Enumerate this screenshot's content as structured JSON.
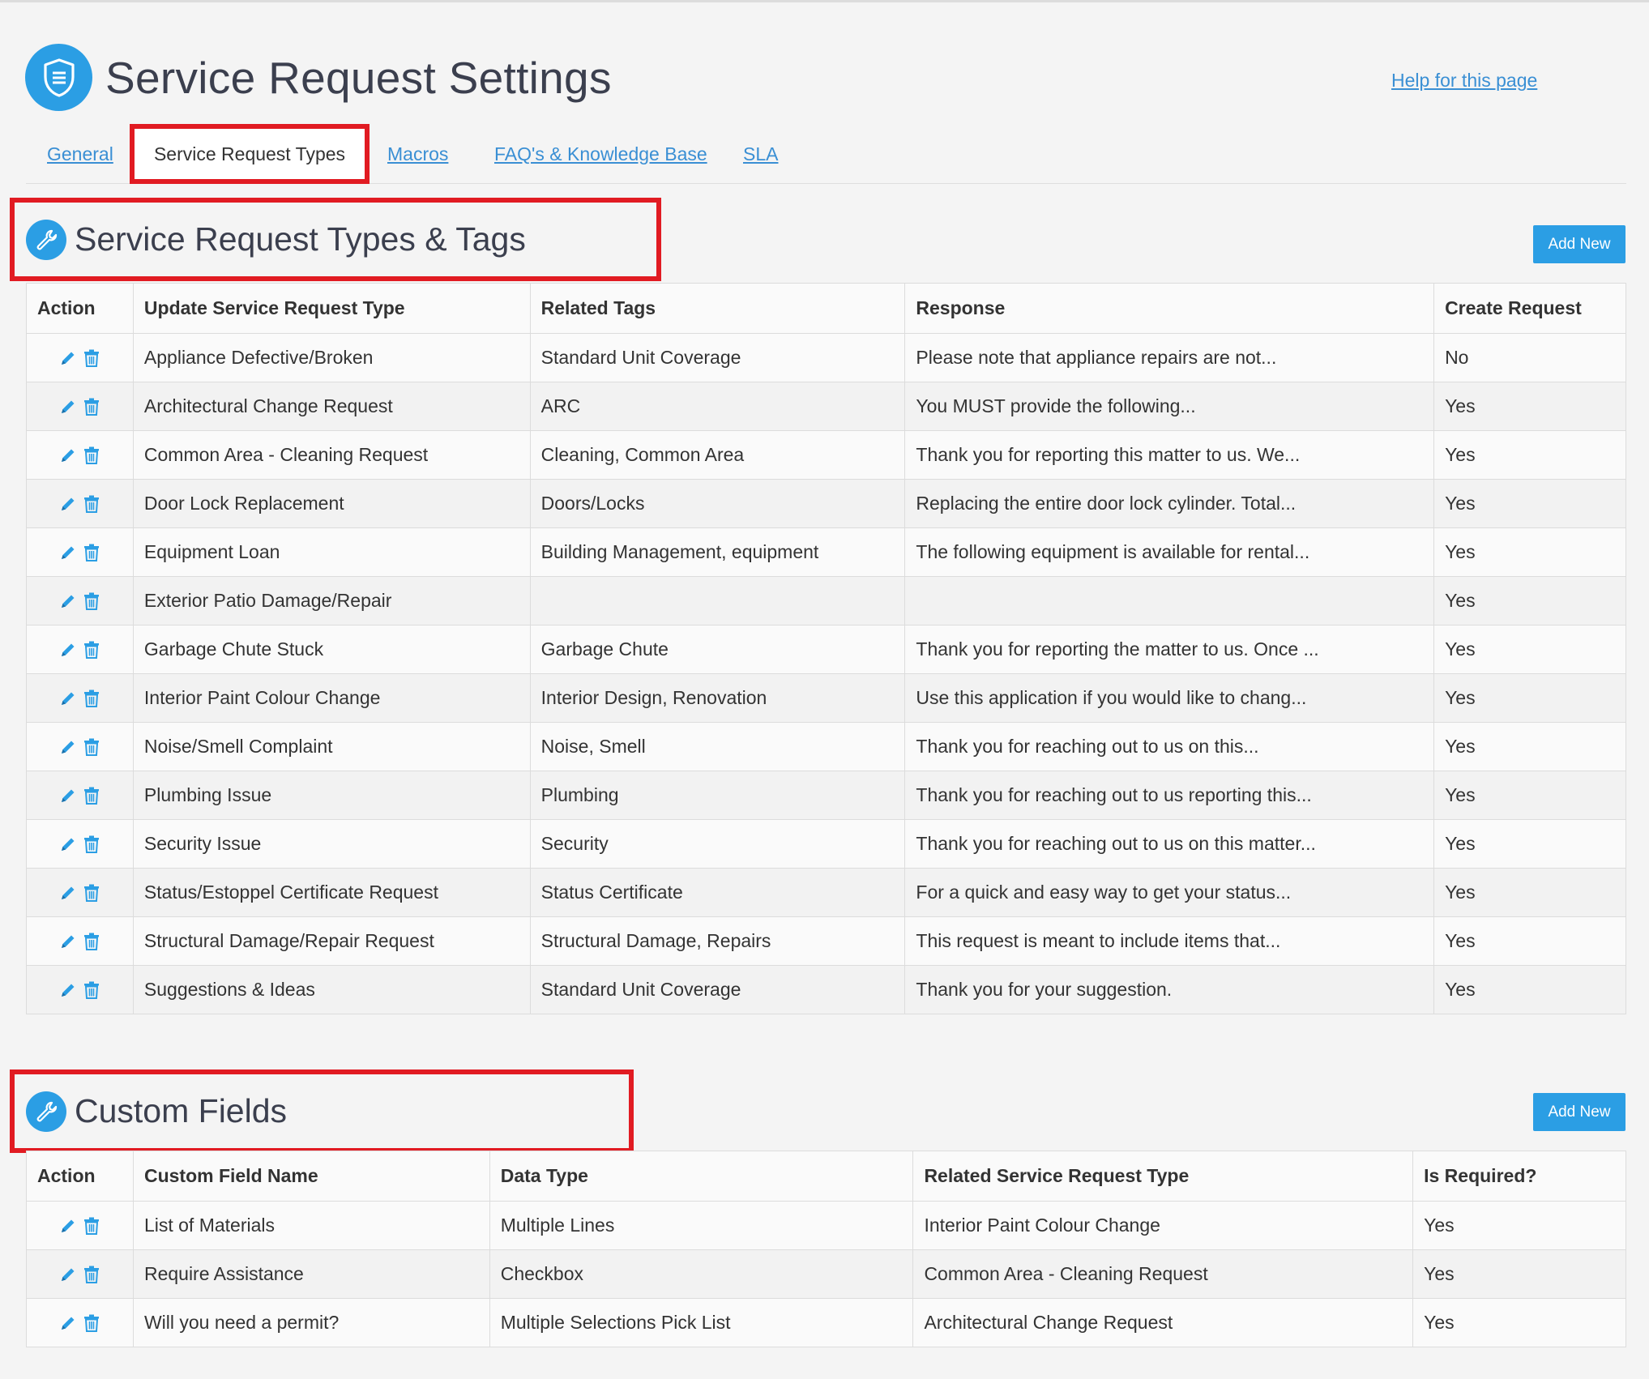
{
  "page": {
    "title": "Service Request Settings",
    "help_link": "Help for this page"
  },
  "tabs": [
    {
      "label": "General"
    },
    {
      "label": "Service Request Types"
    },
    {
      "label": "Macros"
    },
    {
      "label": "FAQ's & Knowledge Base"
    },
    {
      "label": "SLA"
    }
  ],
  "types_section": {
    "title": "Service Request Types & Tags",
    "add_label": "Add New",
    "columns": [
      "Action",
      "Update Service Request Type",
      "Related Tags",
      "Response",
      "Create Request"
    ],
    "rows": [
      {
        "type": "Appliance Defective/Broken",
        "tags": "Standard Unit Coverage",
        "response": "Please note that appliance repairs are not...",
        "create": "No"
      },
      {
        "type": "Architectural Change Request",
        "tags": "ARC",
        "response": "You MUST provide the following...",
        "create": "Yes"
      },
      {
        "type": "Common Area - Cleaning Request",
        "tags": "Cleaning, Common Area",
        "response": "Thank you for reporting this matter to us. We...",
        "create": "Yes"
      },
      {
        "type": "Door Lock Replacement",
        "tags": "Doors/Locks",
        "response": "Replacing the entire door lock cylinder. Total...",
        "create": "Yes"
      },
      {
        "type": "Equipment Loan",
        "tags": "Building Management, equipment",
        "response": "The following equipment is available for rental...",
        "create": "Yes"
      },
      {
        "type": "Exterior Patio Damage/Repair",
        "tags": "",
        "response": "",
        "create": "Yes"
      },
      {
        "type": "Garbage Chute Stuck",
        "tags": "Garbage Chute",
        "response": "Thank you for reporting the matter to us. Once ...",
        "create": "Yes"
      },
      {
        "type": "Interior Paint Colour Change",
        "tags": "Interior Design, Renovation",
        "response": "Use this application if you would like to chang...",
        "create": "Yes"
      },
      {
        "type": "Noise/Smell Complaint",
        "tags": "Noise, Smell",
        "response": "Thank you for reaching out to us on this...",
        "create": "Yes"
      },
      {
        "type": "Plumbing Issue",
        "tags": "Plumbing",
        "response": "Thank you for reaching out to us reporting this...",
        "create": "Yes"
      },
      {
        "type": "Security Issue",
        "tags": "Security",
        "response": "Thank you for reaching out to us on this matter...",
        "create": "Yes"
      },
      {
        "type": "Status/Estoppel Certificate Request",
        "tags": "Status Certificate",
        "response": "For a quick and easy way to get your status...",
        "create": "Yes"
      },
      {
        "type": "Structural Damage/Repair Request",
        "tags": "Structural Damage, Repairs",
        "response": "This request is meant to include items that...",
        "create": "Yes"
      },
      {
        "type": "Suggestions & Ideas",
        "tags": "Standard Unit Coverage",
        "response": "Thank you for your suggestion.",
        "create": "Yes"
      }
    ]
  },
  "custom_section": {
    "title": "Custom Fields",
    "add_label": "Add New",
    "columns": [
      "Action",
      "Custom Field Name",
      "Data Type",
      "Related Service Request Type",
      "Is Required?"
    ],
    "rows": [
      {
        "name": "List of Materials",
        "data_type": "Multiple Lines",
        "related": "Interior Paint Colour Change",
        "required": "Yes"
      },
      {
        "name": "Require Assistance",
        "data_type": "Checkbox",
        "related": "Common Area - Cleaning Request",
        "required": "Yes"
      },
      {
        "name": "Will you need a permit?",
        "data_type": "Multiple Selections Pick List",
        "related": "Architectural Change Request",
        "required": "Yes"
      }
    ]
  },
  "colors": {
    "accent": "#2b9ee4",
    "highlight_box": "#e11b22",
    "link": "#3a8fd4"
  },
  "icons": {
    "logo": "shield-document-icon",
    "section": "wrench-icon",
    "edit": "pencil-icon",
    "delete": "trash-icon"
  }
}
